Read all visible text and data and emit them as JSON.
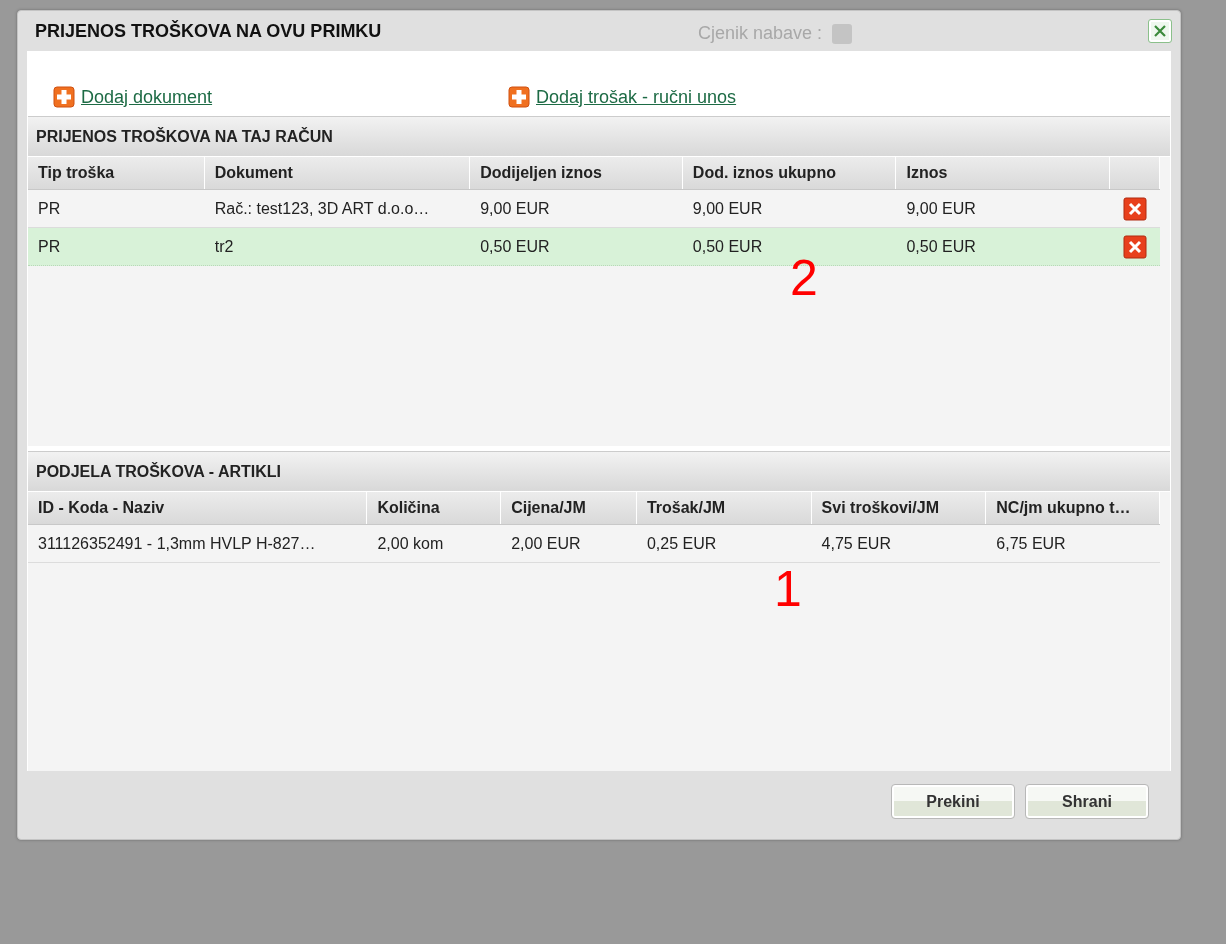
{
  "background": {
    "label": "Cjenik nabave :"
  },
  "dialog": {
    "title": "PRIJENOS TROŠKOVA NA OVU PRIMKU",
    "links": [
      {
        "label": "Dodaj dokument"
      },
      {
        "label": "Dodaj trošak - ručni unos"
      }
    ],
    "sections": [
      {
        "title": "PRIJENOS TROŠKOVA NA TAJ RAČUN",
        "has_delete": true,
        "columns": [
          "Tip troška",
          "Dokument",
          "Dodijeljen iznos",
          "Dod. iznos ukupno",
          "Iznos"
        ],
        "rows": [
          {
            "cells": [
              "PR",
              "Rač.: test123, 3D ART d.o.o…",
              "9,00 EUR",
              "9,00 EUR",
              "9,00 EUR"
            ],
            "selected": false
          },
          {
            "cells": [
              "PR",
              "tr2",
              "0,50 EUR",
              "0,50 EUR",
              "0,50 EUR"
            ],
            "selected": true
          }
        ],
        "annotation": "2"
      },
      {
        "title": "PODJELA TROŠKOVA - ARTIKLI",
        "has_delete": false,
        "columns": [
          "ID - Koda - Naziv",
          "Količina",
          "Cijena/JM",
          "Trošak/JM",
          "Svi troškovi/JM",
          "NC/jm ukupno t…"
        ],
        "rows": [
          {
            "cells": [
              "311126352491 - 1,3mm HVLP H-827…",
              "2,00 kom",
              "2,00 EUR",
              "0,25 EUR",
              "4,75 EUR",
              "6,75 EUR"
            ],
            "selected": false
          }
        ],
        "annotation": "1"
      }
    ],
    "buttons": [
      {
        "label": "Prekini"
      },
      {
        "label": "Shrani"
      }
    ]
  }
}
